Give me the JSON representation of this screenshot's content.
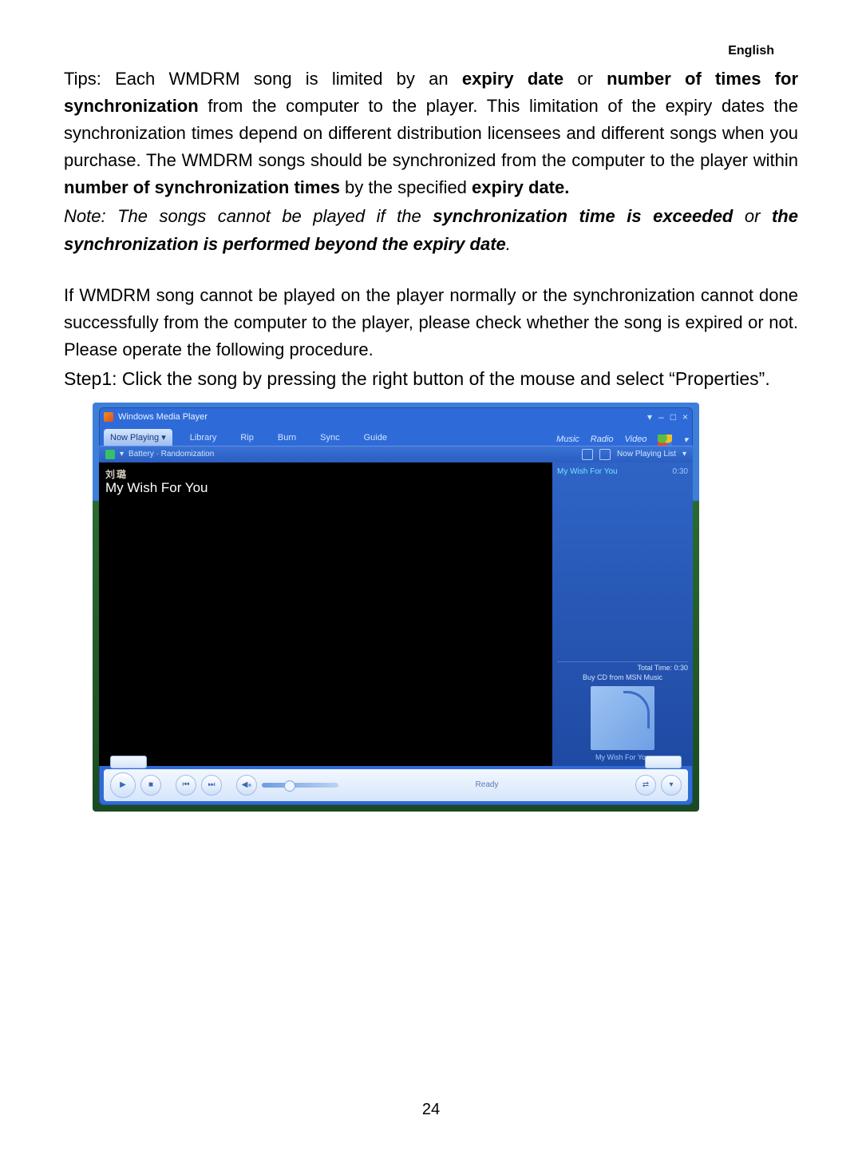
{
  "header_lang": "English",
  "para1": {
    "pre": "Tips: Each WMDRM song is limited by an ",
    "b1": "expiry date",
    "mid1": " or ",
    "b2": "number of times for synchronization",
    "mid2": " from the computer to the player. This limitation of the expiry dates the synchronization times depend on different distribution licensees and different songs when you purchase. The WMDRM songs should be synchronized from the computer to the player within ",
    "b3": "number of synchronization times",
    "mid3": " by the specified ",
    "b4": "expiry date."
  },
  "note": {
    "pre": "Note: The songs cannot be played if the ",
    "b1": "synchronization time is exceeded",
    "mid1": " or ",
    "b2": "the synchronization is performed beyond the expiry date",
    "post": "."
  },
  "para2": "If WMDRM song cannot be played on the player normally or the synchronization cannot done successfully from the computer to the player, please check whether the song is expired or not. Please operate the following procedure.",
  "step1": "Step1: Click the song by pressing the right button of the mouse and select “Properties”.",
  "wmp": {
    "title": "Windows Media Player",
    "win_controls": {
      "down": "▾",
      "min": "–",
      "max": "□",
      "close": "×"
    },
    "tabs": {
      "now_playing": "Now Playing",
      "library": "Library",
      "rip": "Rip",
      "burn": "Burn",
      "sync": "Sync",
      "guide": "Guide"
    },
    "tab_arrow": "▾",
    "right_tabs": {
      "music": "Music",
      "radio": "Radio",
      "video": "Video"
    },
    "subbar_text": "Battery · Randomization",
    "now_playing_list": "Now Playing List",
    "viz_artist": "刘璐",
    "viz_song": "My Wish For You",
    "track_name": "My Wish For You",
    "track_time": "0:30",
    "total_time": "Total Time: 0:30",
    "buy_cd": "Buy CD from MSN Music",
    "art_caption": "My Wish For You",
    "status": "Ready",
    "play_glyph": "▶",
    "stop_glyph": "■",
    "prev_glyph": "⏮",
    "next_glyph": "⏭",
    "mute_glyph": "◀⁎"
  },
  "page_number": "24"
}
